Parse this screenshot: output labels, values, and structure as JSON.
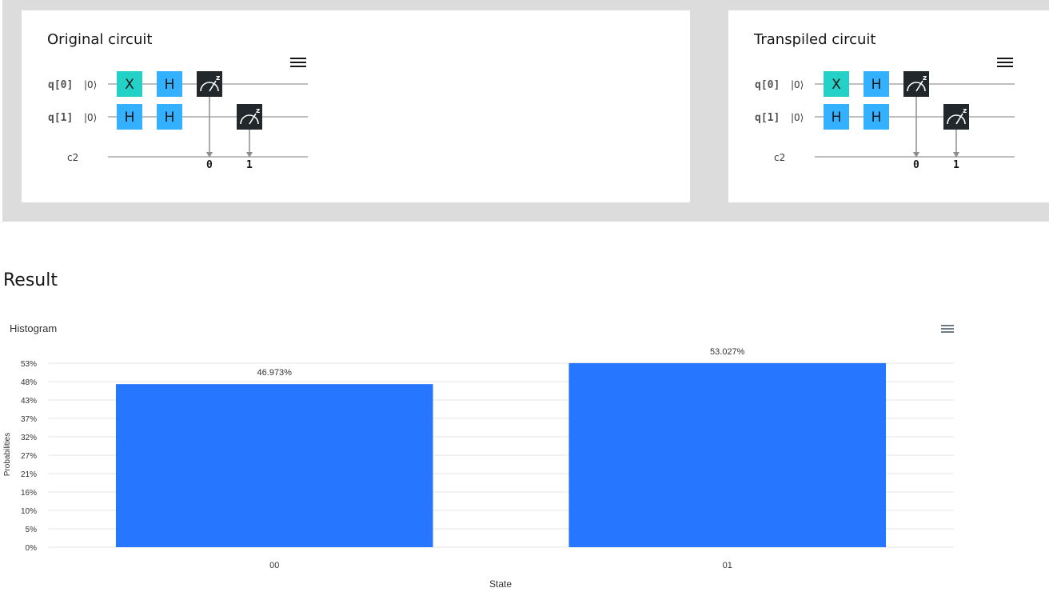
{
  "original": {
    "title": "Original circuit",
    "labels": {
      "q0": "q[0]",
      "q1": "q[1]",
      "c": "c2",
      "ket": "|0⟩"
    },
    "gates": {
      "x": "X",
      "h": "H"
    },
    "meas_label": "z",
    "bits": [
      "0",
      "1"
    ]
  },
  "transpiled": {
    "title": "Transpiled circuit",
    "labels": {
      "q0": "q[0]",
      "q1": "q[1]",
      "c": "c2",
      "ket": "|0⟩"
    },
    "gates": {
      "x": "X",
      "h": "H"
    },
    "meas_label": "z",
    "bits": [
      "0",
      "1"
    ]
  },
  "colors": {
    "x_gate": "#24d1c6",
    "h_gate": "#33b1ff",
    "measure": "#21272a",
    "bar": "#2776ff"
  },
  "result": {
    "title": "Result"
  },
  "chart_data": {
    "type": "bar",
    "title": "Histogram",
    "xlabel": "State",
    "ylabel": "Probabilities",
    "categories": [
      "00",
      "01"
    ],
    "values": [
      46.973,
      53.027
    ],
    "data_labels": [
      "46.973%",
      "53.027%"
    ],
    "y_ticks": [
      "0%",
      "5%",
      "10%",
      "16%",
      "21%",
      "27%",
      "32%",
      "37%",
      "43%",
      "48%",
      "53%"
    ],
    "ylim": [
      0,
      53
    ],
    "grid": true
  }
}
